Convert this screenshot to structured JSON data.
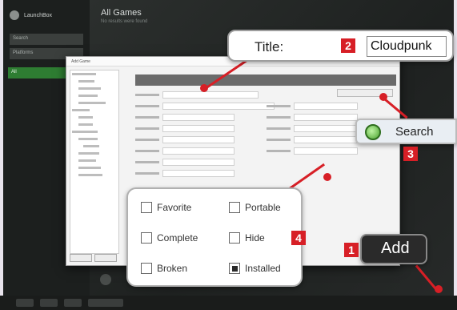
{
  "app": {
    "sidebar_title": "LaunchBox",
    "sidebar_search": "Search",
    "sidebar_platform": "Platforms",
    "sidebar_active": "All",
    "main_title": "All Games",
    "main_subtitle": "No results were found"
  },
  "dialog": {
    "window_title": "Add Game"
  },
  "callouts": {
    "title_label": "Title:",
    "title_value": "Cloudpunk",
    "badge_title": "2",
    "search_label": "Search",
    "badge_search": "3",
    "badge_attributes": "4",
    "add_label": "Add",
    "badge_add": "1"
  },
  "attributes": [
    {
      "label": "Favorite",
      "checked": false
    },
    {
      "label": "Portable",
      "checked": false
    },
    {
      "label": "Complete",
      "checked": false
    },
    {
      "label": "Hide",
      "checked": false
    },
    {
      "label": "Broken",
      "checked": false
    },
    {
      "label": "Installed",
      "checked": true
    }
  ],
  "colors": {
    "badge": "#d71f26",
    "sidebar_active": "#2e7d32",
    "search_icon": "#4aa32f"
  },
  "icons": {
    "search": "search-icon",
    "logo": "app-logo-icon"
  }
}
